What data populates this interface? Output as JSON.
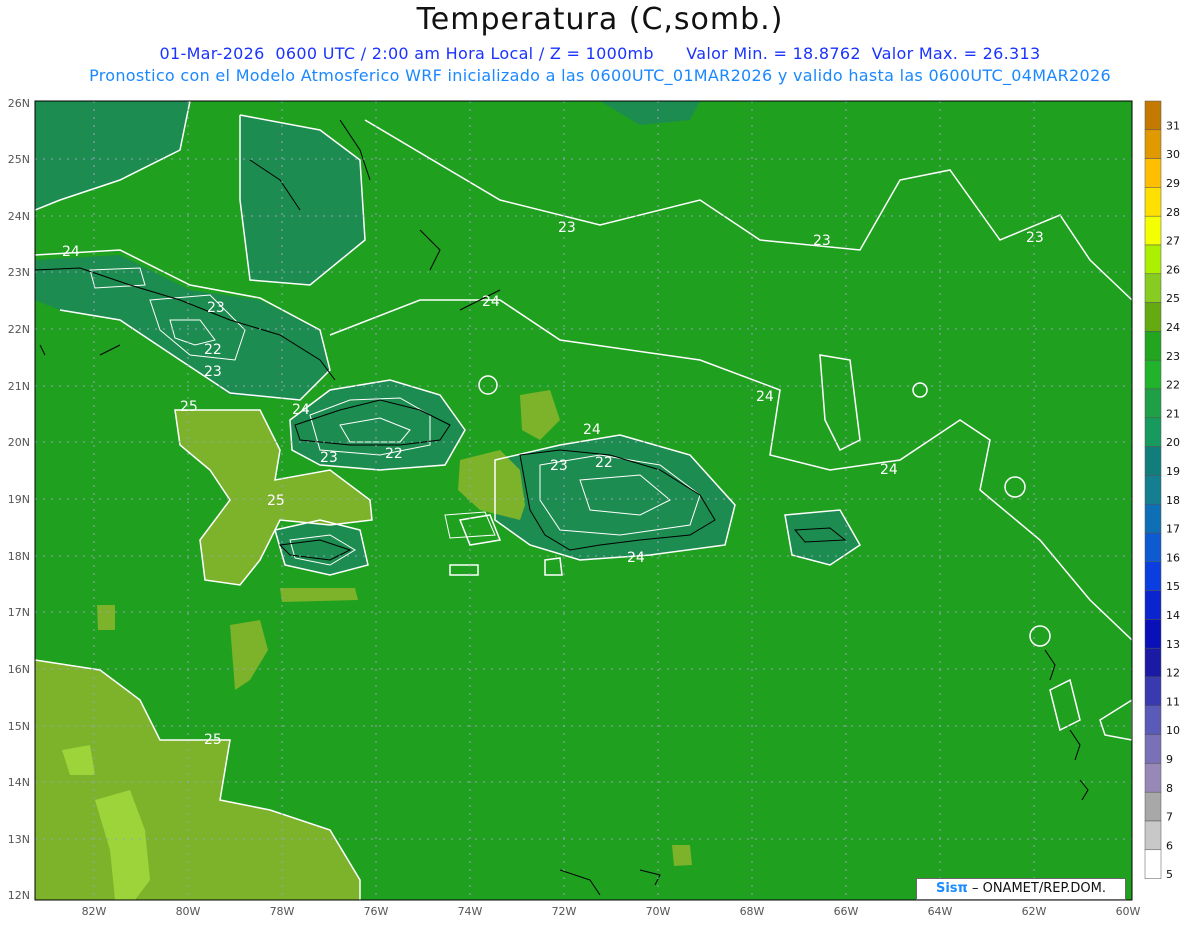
{
  "title": "Temperatura (C,somb.)",
  "subtitle": {
    "datetime": "01-Mar-2026  0600 UTC / 2:00 am Hora Local / Z = 1000mb",
    "min": "Valor Min. = 18.8762",
    "max": "Valor Max. = 26.313"
  },
  "subtitle2": "Pronostico con el Modelo Atmosferico WRF inicializado a las 0600UTC_01MAR2026 y valido hasta las  0600UTC_04MAR2026",
  "credit": {
    "brand": "Sisπ",
    "text": "– ONAMET/REP.DOM."
  },
  "axes": {
    "lat_labels": [
      "26N",
      "25N",
      "24N",
      "23N",
      "22N",
      "21N",
      "20N",
      "19N",
      "18N",
      "17N",
      "16N",
      "15N",
      "14N",
      "13N",
      "12N"
    ],
    "lon_labels": [
      "82W",
      "80W",
      "78W",
      "76W",
      "74W",
      "72W",
      "70W",
      "68W",
      "66W",
      "64W",
      "62W",
      "60W"
    ]
  },
  "colorbar": {
    "labels": [
      "31",
      "30",
      "29",
      "28",
      "27",
      "26",
      "25",
      "24",
      "23",
      "22",
      "21",
      "20",
      "19",
      "18",
      "17",
      "16",
      "15",
      "14",
      "13",
      "12",
      "11",
      "10",
      "9",
      "8",
      "7",
      "6",
      "5"
    ],
    "colors": [
      "#c47a00",
      "#e09a00",
      "#ffbf00",
      "#ffe000",
      "#f4ff00",
      "#aaf000",
      "#88cc22",
      "#66aa11",
      "#22a51f",
      "#22b32c",
      "#1fa046",
      "#179a5e",
      "#117e7c",
      "#137f90",
      "#0f6fb6",
      "#0e5ad0",
      "#0a3ee0",
      "#0a24d0",
      "#0a10b8",
      "#1a1aa5",
      "#3a3ab0",
      "#5a5ab8",
      "#7a70b8",
      "#9888b8",
      "#a8a8a8",
      "#c8c8c8",
      "#ffffff"
    ]
  },
  "contour_labels": [
    "24",
    "23",
    "22",
    "23",
    "25",
    "24",
    "23",
    "22",
    "25",
    "24",
    "23",
    "22",
    "24",
    "24",
    "24",
    "23",
    "23",
    "23",
    "25"
  ],
  "colors": {
    "background_field": "#1fa01f",
    "warm_field": "#7cb32a",
    "cool_field": "#1c8c50",
    "contour": "#ffffff",
    "coast": "#000000",
    "grid": "#9aa0c0"
  }
}
